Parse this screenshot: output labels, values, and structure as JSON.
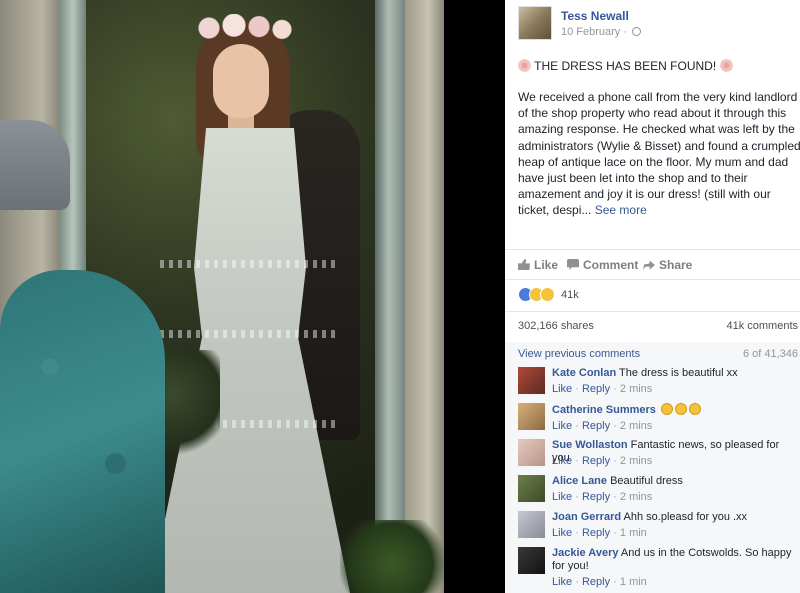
{
  "post": {
    "author": "Tess Newall",
    "date": "10 February",
    "date_separator": "·",
    "headline": "THE DRESS HAS BEEN FOUND!",
    "body": "We received a phone call from the very kind landlord of the shop property who read about it through this amazing response. He checked what was left by the administrators (Wylie & Bisset) and found a crumpled heap of antique lace on the floor. My mum and dad have just been let into the shop and to their amazement and joy it is our dress! (still with our ticket, despi...",
    "see_more": "See more",
    "actions": {
      "like": "Like",
      "comment": "Comment",
      "share": "Share"
    },
    "reactions": {
      "count": "41k",
      "types": [
        "like-icon",
        "sad-icon",
        "wow-icon"
      ]
    },
    "shares": "302,166 shares",
    "comments_count": "41k comments"
  },
  "comments_panel": {
    "view_previous": "View previous comments",
    "counter": "6 of 41,346",
    "comments": [
      {
        "name": "Kate Conlan",
        "text": "The dress is beautiful xx",
        "like": "Like",
        "reply": "Reply",
        "sep": "·",
        "time": "2 mins"
      },
      {
        "name": "Catherine Summers",
        "text": "",
        "emoji": [
          "laughing-face-icon",
          "laughing-face-icon",
          "laughing-face-icon"
        ],
        "like": "Like",
        "reply": "Reply",
        "sep": "·",
        "time": "2 mins"
      },
      {
        "name": "Sue Wollaston",
        "text": "Fantastic news, so pleased for you",
        "like": "Like",
        "reply": "Reply",
        "sep": "·",
        "time": "2 mins"
      },
      {
        "name": "Alice Lane",
        "text": "Beautiful dress",
        "like": "Like",
        "reply": "Reply",
        "sep": "·",
        "time": "2 mins"
      },
      {
        "name": "Joan Gerrard",
        "text": "Ahh so.pleasd for you .xx",
        "like": "Like",
        "reply": "Reply",
        "sep": "·",
        "time": "1 min"
      },
      {
        "name": "Jackie Avery",
        "text": "And us in the Cotswolds. So happy for you!",
        "like": "Like",
        "reply": "Reply",
        "sep": "·",
        "time": "1 min"
      }
    ]
  },
  "colors": {
    "link": "#365899",
    "meta": "#90949c",
    "panel_bg": "#f6f7f9"
  }
}
